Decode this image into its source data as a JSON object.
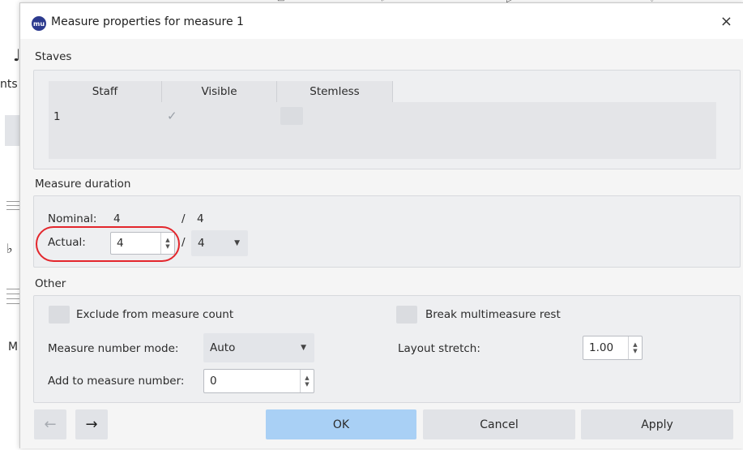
{
  "background": {
    "fragments": [
      "nts",
      "M"
    ]
  },
  "dialog": {
    "app_icon_text": "mu",
    "title": "Measure properties for measure 1",
    "close_symbol": "×"
  },
  "staves": {
    "section_label": "Staves",
    "columns": [
      "Staff",
      "Visible",
      "Stemless"
    ],
    "rows": [
      {
        "staff": "1",
        "visible_mark": "✓"
      }
    ]
  },
  "measure_duration": {
    "section_label": "Measure duration",
    "nominal_label": "Nominal:",
    "nominal_numerator": "4",
    "nominal_separator": "/",
    "nominal_denominator": "4",
    "actual_label": "Actual:",
    "actual_numerator": "4",
    "actual_separator": "/",
    "actual_denominator": "4"
  },
  "other": {
    "section_label": "Other",
    "exclude_label": "Exclude from measure count",
    "break_rest_label": "Break multimeasure rest",
    "number_mode_label": "Measure number mode:",
    "number_mode_value": "Auto",
    "layout_stretch_label": "Layout stretch:",
    "layout_stretch_value": "1.00",
    "add_to_number_label": "Add to measure number:",
    "add_to_number_value": "0"
  },
  "footer": {
    "prev_arrow": "←",
    "next_arrow": "→",
    "ok_label": "OK",
    "cancel_label": "Cancel",
    "apply_label": "Apply"
  },
  "colors": {
    "highlight": "#e3262c",
    "primary_button": "#a9d0f5"
  }
}
